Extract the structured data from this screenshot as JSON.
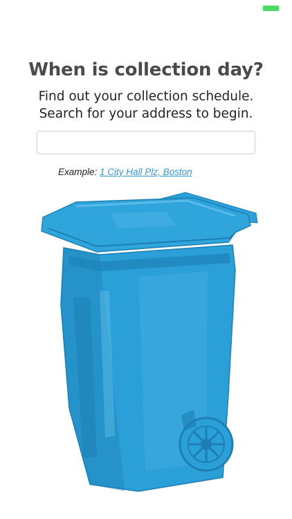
{
  "heading": "When is collection day?",
  "intro": {
    "line1": "Find out your collection schedule.",
    "line2": "Search for your address to begin."
  },
  "search": {
    "value": "",
    "placeholder": ""
  },
  "example": {
    "label": "Example:",
    "link_text": "1 City Hall Plz, Boston"
  },
  "colors": {
    "status_indicator": "#4cd964",
    "cart_primary": "#2a9fd8",
    "cart_shadow": "#1d7fb3",
    "cart_highlight": "#5bbbe8",
    "link": "#3399cc"
  },
  "illustration": {
    "icon": "trash-cart-icon"
  }
}
